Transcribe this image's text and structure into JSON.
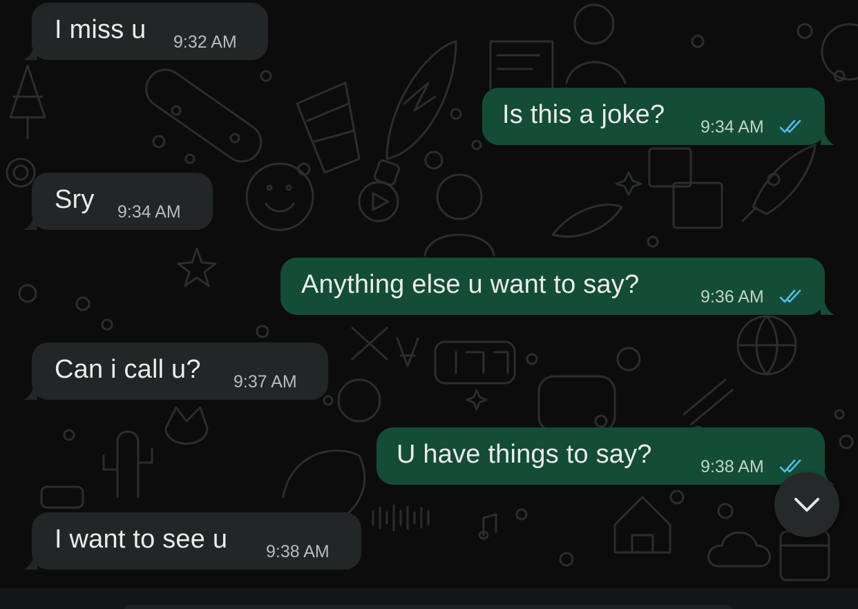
{
  "messages": [
    {
      "direction": "incoming",
      "text": "I miss u",
      "time": "9:32 AM"
    },
    {
      "direction": "outgoing",
      "text": "Is this a joke?",
      "time": "9:34 AM",
      "status": "read"
    },
    {
      "direction": "incoming",
      "text": "Sry",
      "time": "9:34 AM"
    },
    {
      "direction": "outgoing",
      "text": "Anything else u want to say?",
      "time": "9:36 AM",
      "status": "read"
    },
    {
      "direction": "incoming",
      "text": "Can i call u?",
      "time": "9:37 AM"
    },
    {
      "direction": "outgoing",
      "text": "U have things to say?",
      "time": "9:38 AM",
      "status": "read"
    },
    {
      "direction": "incoming",
      "text": "I want to see u",
      "time": "9:38 AM"
    }
  ],
  "scroll_button": {
    "icon": "chevron-down-icon"
  },
  "colors": {
    "incoming_bubble": "#232626",
    "outgoing_bubble": "#134d37",
    "read_ticks": "#53bdeb",
    "background": "#0c0c0c"
  }
}
